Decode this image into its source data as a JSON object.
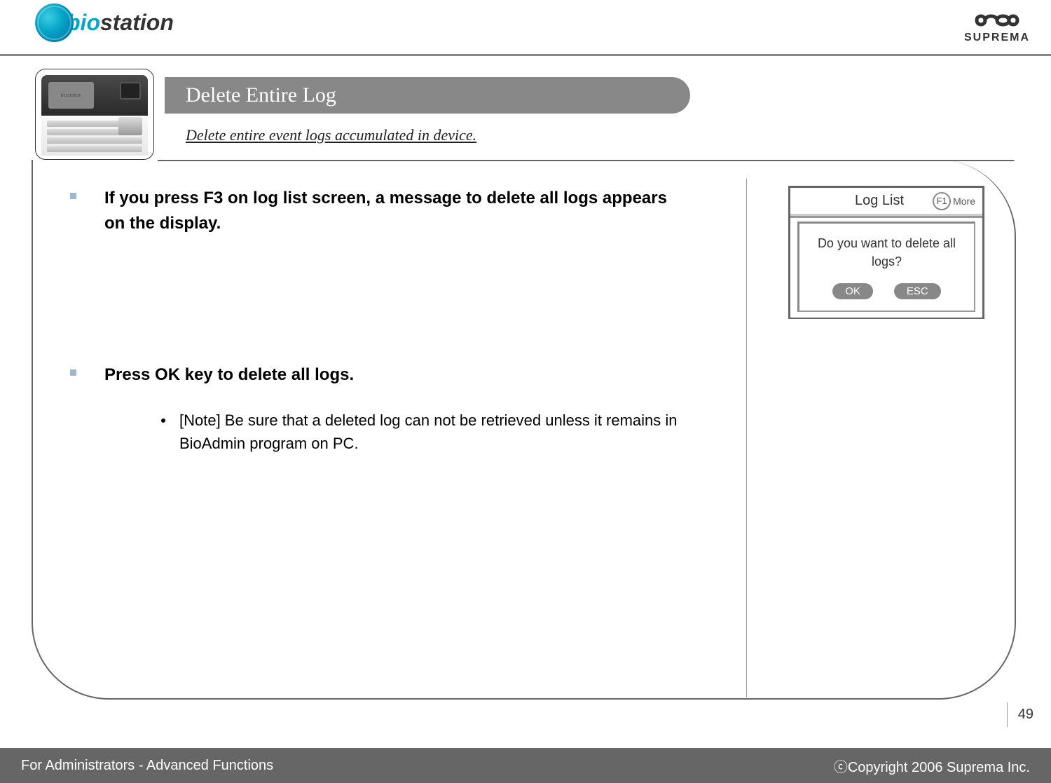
{
  "header": {
    "logo_left_text": "station",
    "logo_right_text": "SUPREMA"
  },
  "title_bar": "Delete Entire Log",
  "subtitle": "Delete entire event logs accumulated in device.",
  "device_screen_label": "biostation",
  "bullets": [
    {
      "text": "If you press F3 on log list screen, a message to delete all logs appears on the display."
    },
    {
      "text": "Press OK key to delete all logs.",
      "sub": "[Note] Be sure that a deleted log can not be retrieved unless it remains in BioAdmin program on PC."
    }
  ],
  "mockup": {
    "title": "Log List",
    "f1": "F1",
    "more": "More",
    "dialog_text": "Do you want to delete all logs?",
    "ok_label": "OK",
    "esc_label": "ESC"
  },
  "page_number": "49",
  "footer": {
    "left": "For Administrators - Advanced Functions",
    "right": "ⓒCopyright 2006 Suprema Inc."
  }
}
